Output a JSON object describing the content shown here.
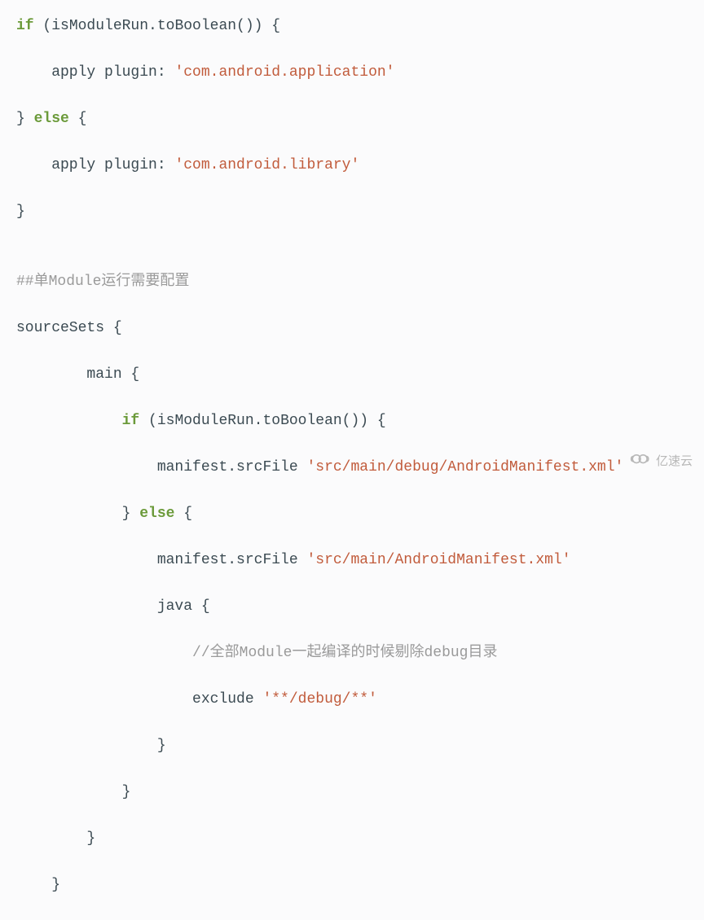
{
  "code": {
    "l1_a": "if",
    "l1_b": " (isModuleRun.toBoolean()) {",
    "l2_a": "    apply plugin: ",
    "l2_b": "'com.android.application'",
    "l3_a": "} ",
    "l3_b": "else",
    "l3_c": " {",
    "l4_a": "    apply plugin: ",
    "l4_b": "'com.android.library'",
    "l5_a": "}",
    "l6_a": "",
    "l7_a": "##单Module运行需要配置",
    "l8_a": "sourceSets {",
    "l9_a": "        main {",
    "l10_a": "            ",
    "l10_b": "if",
    "l10_c": " (isModuleRun.toBoolean()) {",
    "l11_a": "                manifest.srcFile ",
    "l11_b": "'src/main/debug/AndroidManifest.xml'",
    "l12_a": "            } ",
    "l12_b": "else",
    "l12_c": " {",
    "l13_a": "                manifest.srcFile ",
    "l13_b": "'src/main/AndroidManifest.xml'",
    "l14_a": "                java {",
    "l15_a": "                    ",
    "l15_b": "//全部Module一起编译的时候剔除debug目录",
    "l16_a": "                    exclude ",
    "l16_b": "'**/debug/**'",
    "l17_a": "                }",
    "l18_a": "            }",
    "l19_a": "        }",
    "l20_a": "    }"
  },
  "watermark": {
    "text": "亿速云"
  }
}
